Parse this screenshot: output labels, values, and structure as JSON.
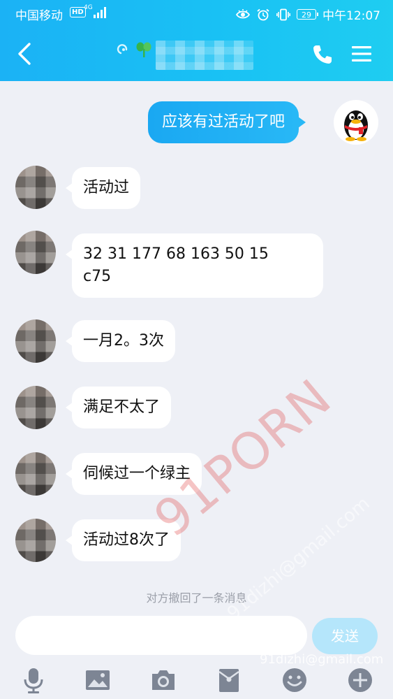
{
  "status_bar": {
    "carrier": "中国移动",
    "hd": "HD",
    "network": "4G",
    "battery": "29",
    "time": "中午12:07"
  },
  "header": {
    "contact_name": ""
  },
  "messages": [
    {
      "direction": "outgoing",
      "text": "应该有过活动了吧"
    },
    {
      "direction": "incoming",
      "text": "活动过"
    },
    {
      "direction": "incoming",
      "text": "32 31 177 68 163 50 15\nc75"
    },
    {
      "direction": "incoming",
      "text": "一月2。3次"
    },
    {
      "direction": "incoming",
      "text": "满足不太了"
    },
    {
      "direction": "incoming",
      "text": "伺候过一个绿主"
    },
    {
      "direction": "incoming",
      "text": "活动过8次了"
    }
  ],
  "recall_notice": "对方撤回了一条消息",
  "input": {
    "value": "",
    "send_label": "发送"
  },
  "toolbar": {
    "items": [
      "microphone-icon",
      "image-icon",
      "camera-icon",
      "red-packet-icon",
      "emoji-icon",
      "plus-icon"
    ]
  },
  "watermark": {
    "brand": "91PORN",
    "email": "91dizhi@gmail.com"
  },
  "colors": {
    "header_gradient_start": "#1bb2f5",
    "header_gradient_end": "#1fcdf1",
    "chat_background": "#eef0f6",
    "outgoing_bubble": "#1aa8f2",
    "incoming_bubble": "#ffffff",
    "send_button": "#b5e6fb"
  }
}
